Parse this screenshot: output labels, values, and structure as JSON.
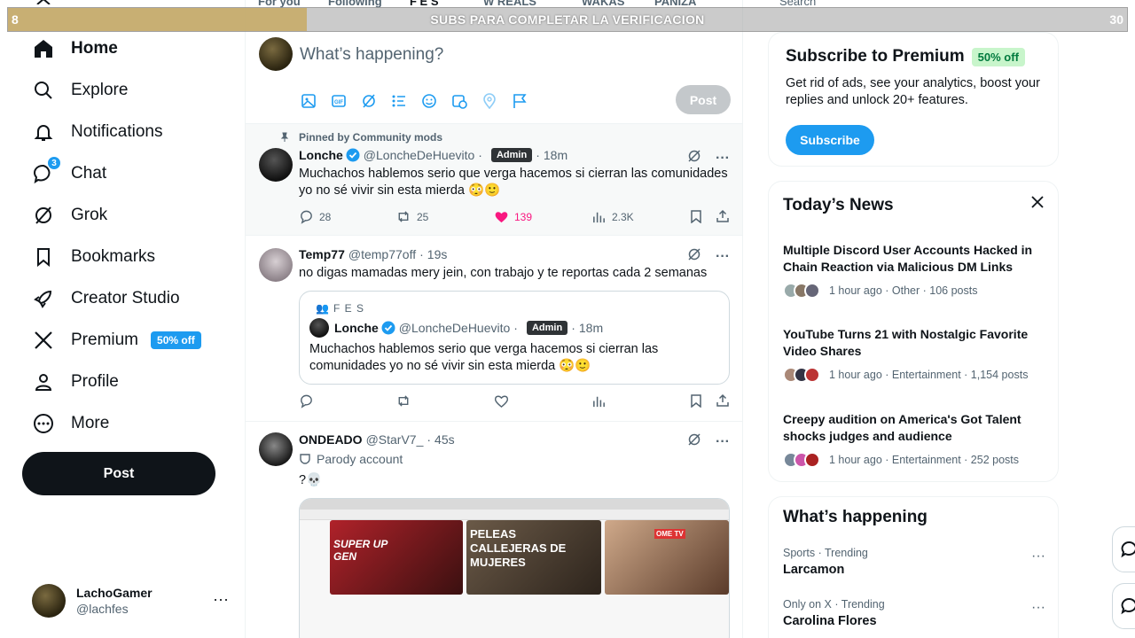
{
  "overlay": {
    "ghost_tabs": [
      "For you",
      "Following",
      "F E S",
      "W REALS",
      "WAKAS",
      "PANIZA"
    ],
    "search_placeholder": "Search",
    "progress_left": "8",
    "progress_right": "30",
    "progress_label": "SUBS PARA COMPLETAR LA VERIFICACION",
    "progress_fraction": 0.267
  },
  "sidebar": {
    "items": [
      {
        "label": "Home",
        "icon": "home-icon"
      },
      {
        "label": "Explore",
        "icon": "search-icon"
      },
      {
        "label": "Notifications",
        "icon": "bell-icon"
      },
      {
        "label": "Chat",
        "icon": "chat-icon",
        "badge": "3"
      },
      {
        "label": "Grok",
        "icon": "grok-icon"
      },
      {
        "label": "Bookmarks",
        "icon": "bookmark-icon"
      },
      {
        "label": "Creator Studio",
        "icon": "rocket-icon"
      },
      {
        "label": "Premium",
        "icon": "x-logo-icon",
        "pill": "50% off"
      },
      {
        "label": "Profile",
        "icon": "person-icon"
      },
      {
        "label": "More",
        "icon": "more-circle-icon"
      }
    ],
    "post_button": "Post",
    "user": {
      "display_name": "LachoGamer",
      "handle": "@lachfes",
      "menu": "···"
    }
  },
  "composer": {
    "placeholder": "What’s happening?",
    "post_button": "Post"
  },
  "tweets": [
    {
      "pinned": "Pinned by Community mods",
      "name": "Lonche",
      "handle": "@LoncheDeHuevito",
      "badge": "Admin",
      "time": "18m",
      "text": "Muchachos hablemos serio que verga hacemos si cierran las comunidades yo no sé vivir sin esta mierda 😳🙂",
      "replies": "28",
      "reposts": "25",
      "likes": "139",
      "views": "2.3K"
    },
    {
      "name": "Temp77",
      "handle": "@temp77off",
      "time": "19s",
      "text": "no digas mamadas mery jein, con trabajo y te reportas cada 2 semanas",
      "quote": {
        "community": "F E S",
        "name": "Lonche",
        "handle": "@LoncheDeHuevito",
        "badge": "Admin",
        "time": "18m",
        "text": "Muchachos hablemos serio que verga hacemos si cierran las comunidades yo no sé vivir sin esta mierda 😳🙂"
      }
    },
    {
      "name": "ONDEADO",
      "handle": "@StarV7_",
      "time": "45s",
      "parody": "Parody account",
      "text": "?💀",
      "media_thumbs": [
        "SUPER UP GEN",
        "PELEAS CALLEJERAS DE MUJERES",
        "OME TV"
      ]
    }
  ],
  "premium_card": {
    "title": "Subscribe to Premium",
    "pill": "50% off",
    "text": "Get rid of ads, see your analytics, boost your replies and unlock 20+ features.",
    "button": "Subscribe"
  },
  "news": {
    "title": "Today’s News",
    "items": [
      {
        "title": "Multiple Discord User Accounts Hacked in Chain Reaction via Malicious DM Links",
        "meta": "1 hour ago · Other · 106 posts"
      },
      {
        "title": "YouTube Turns 21 with Nostalgic Favorite Video Shares",
        "meta": "1 hour ago · Entertainment · 1,154 posts"
      },
      {
        "title": "Creepy audition on America's Got Talent shocks judges and audience",
        "meta": "1 hour ago · Entertainment · 252 posts"
      }
    ]
  },
  "happening": {
    "title": "What’s happening",
    "trends": [
      {
        "context": "Sports · Trending",
        "name": "Larcamon"
      },
      {
        "context": "Only on X · Trending",
        "name": "Carolina Flores"
      }
    ]
  },
  "colors": {
    "accent": "#1d9bf0",
    "like": "#f91880",
    "text": "#0f1419",
    "muted": "#536471"
  }
}
